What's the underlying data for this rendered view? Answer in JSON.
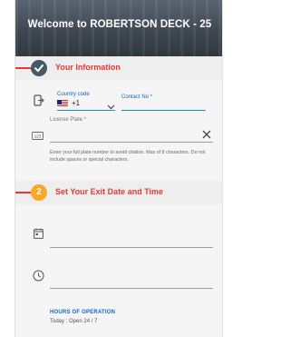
{
  "header": {
    "title": "Welcome to ROBERTSON DECK - 25"
  },
  "section1": {
    "title": "Your Information",
    "step_icon": "check-icon",
    "color": "#e53935",
    "step_color": "#455a64"
  },
  "phone": {
    "country_code_label": "Country code",
    "country_code_value": "+1",
    "flag_icon": "us-flag-icon",
    "contact_label": "Contact No *"
  },
  "plate": {
    "label": "License Plate *",
    "help": "Enter your full plate number to avoid citation. Max of 8 characters. Do not include spaces or special characters."
  },
  "section2": {
    "title": "Set Your Exit Date and Time",
    "step": "2",
    "step_color": "#f9a825"
  },
  "hours": {
    "title": "HOURS OF OPERATION",
    "value": "Today : Open 24 / 7"
  }
}
